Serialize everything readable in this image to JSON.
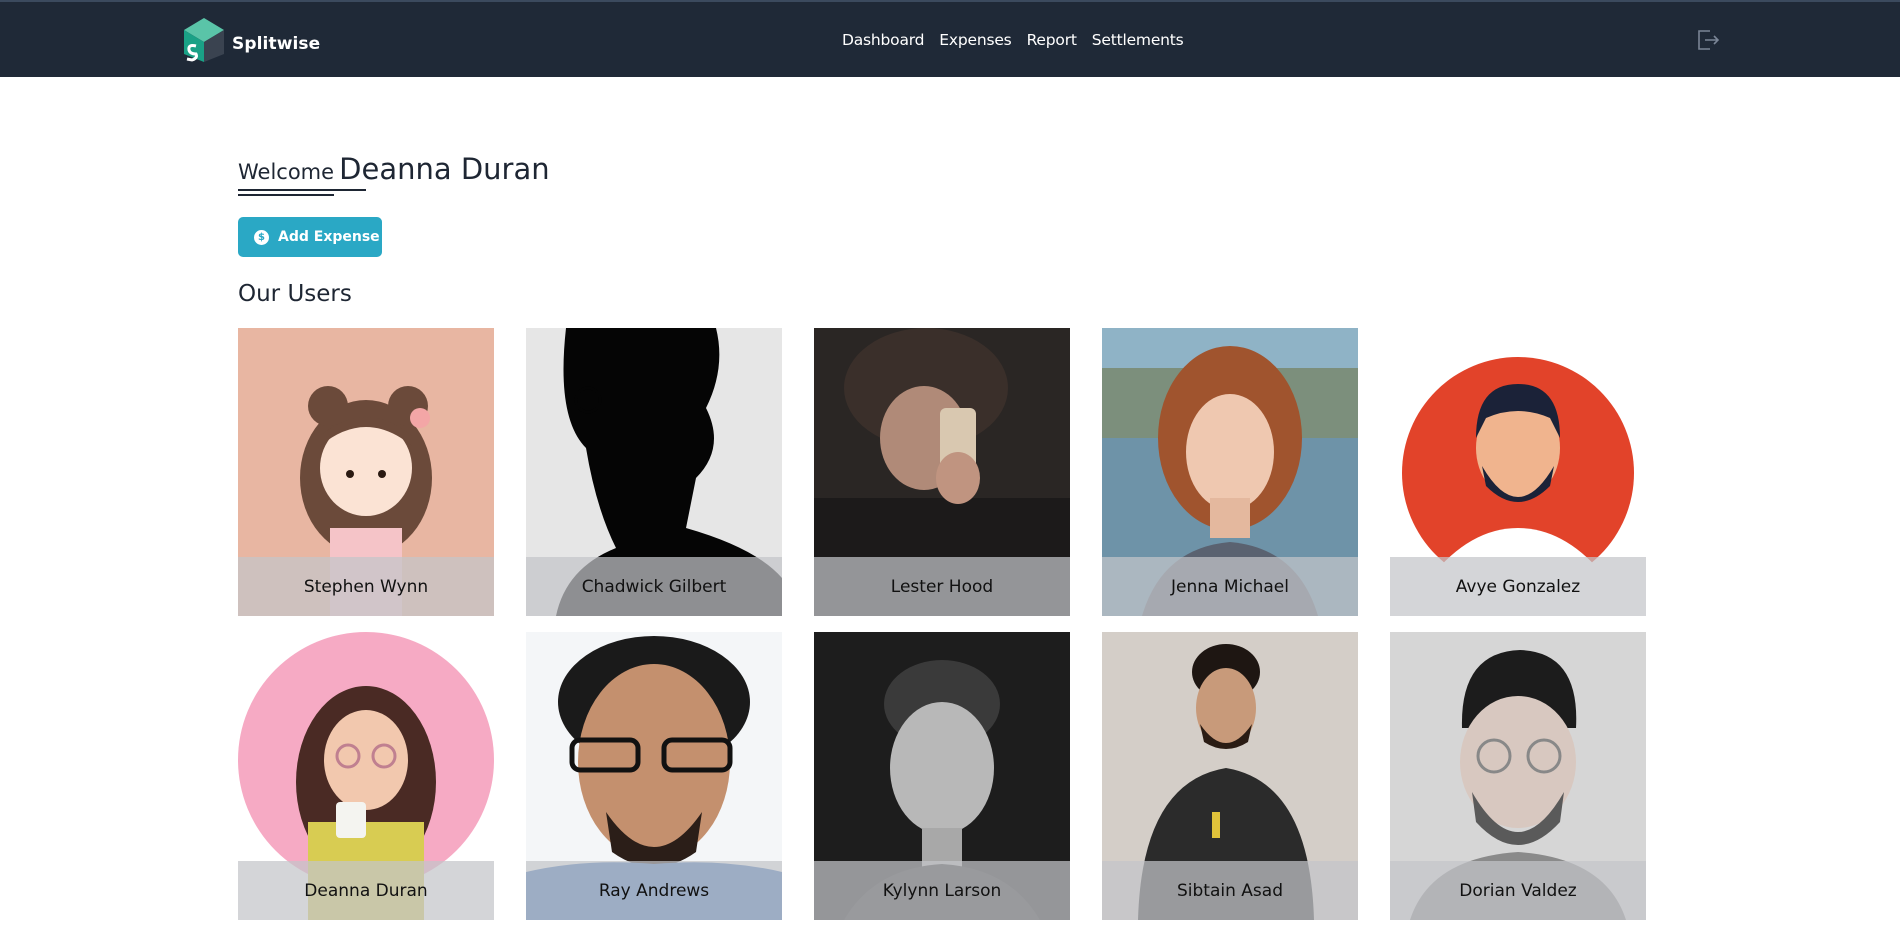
{
  "app": {
    "brand": "Splitwise",
    "accent_color": "#2aa8c5",
    "navbar_color": "#1f2937"
  },
  "nav": {
    "links": [
      "Dashboard",
      "Expenses",
      "Report",
      "Settlements"
    ],
    "logout_icon": "logout-icon"
  },
  "welcome": {
    "prefix": "Welcome",
    "name": "Deanna Duran"
  },
  "actions": {
    "add_expense_label": "Add Expense",
    "add_expense_icon": "dollar-circle-icon"
  },
  "users_section": {
    "title": "Our Users",
    "users": [
      {
        "name": "Stephen Wynn"
      },
      {
        "name": "Chadwick Gilbert"
      },
      {
        "name": "Lester Hood"
      },
      {
        "name": "Jenna Michael"
      },
      {
        "name": "Avye Gonzalez"
      },
      {
        "name": "Deanna Duran"
      },
      {
        "name": "Ray Andrews"
      },
      {
        "name": "Kylynn Larson"
      },
      {
        "name": "Sibtain Asad"
      },
      {
        "name": "Dorian Valdez"
      }
    ]
  }
}
